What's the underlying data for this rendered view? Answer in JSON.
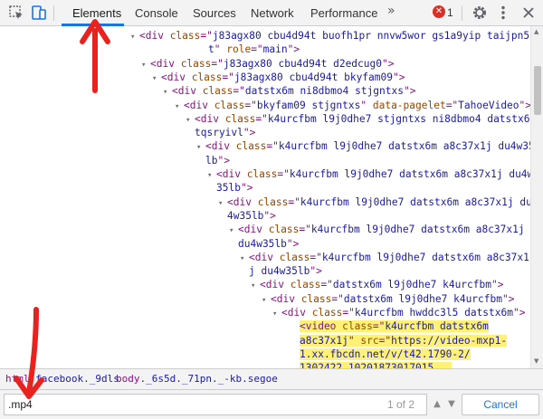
{
  "toolbar": {
    "tabs": [
      {
        "label": "Elements",
        "active": true
      },
      {
        "label": "Console",
        "active": false
      },
      {
        "label": "Sources",
        "active": false
      },
      {
        "label": "Network",
        "active": false
      },
      {
        "label": "Performance",
        "active": false
      }
    ],
    "more_tabs": "»",
    "error_count": "1",
    "icons": [
      "inspect-element-icon",
      "device-toggle-icon",
      "error-icon",
      "settings-gear-icon",
      "more-options-icon"
    ]
  },
  "tree": {
    "lines": [
      {
        "triangle": "▾",
        "parts": [
          [
            "t",
            "<div "
          ],
          [
            "a",
            "class"
          ],
          [
            "t",
            "=\""
          ],
          [
            "v",
            "j83agx80 cbu4d94t buofh1pr nnvw5wor gs1a9yip taijpn5"
          ]
        ]
      },
      {
        "triangle": "",
        "parts": [
          [
            "v",
            "t"
          ],
          [
            "t",
            "\" "
          ],
          [
            "a",
            "role"
          ],
          [
            "t",
            "=\""
          ],
          [
            "v",
            "main"
          ],
          [
            "t",
            "\">"
          ]
        ]
      },
      {
        "triangle": "▾",
        "parts": [
          [
            "t",
            "<div "
          ],
          [
            "a",
            "class"
          ],
          [
            "t",
            "=\""
          ],
          [
            "v",
            "j83agx80 cbu4d94t d2edcug0"
          ],
          [
            "t",
            "\">"
          ]
        ]
      },
      {
        "triangle": "▾",
        "parts": [
          [
            "t",
            "<div "
          ],
          [
            "a",
            "class"
          ],
          [
            "t",
            "=\""
          ],
          [
            "v",
            "j83agx80 cbu4d94t bkyfam09"
          ],
          [
            "t",
            "\">"
          ]
        ]
      },
      {
        "triangle": "▾",
        "parts": [
          [
            "t",
            "<div "
          ],
          [
            "a",
            "class"
          ],
          [
            "t",
            "=\""
          ],
          [
            "v",
            "datstx6m ni8dbmo4 stjgntxs"
          ],
          [
            "t",
            "\">"
          ]
        ]
      },
      {
        "triangle": "▾",
        "parts": [
          [
            "t",
            "<div "
          ],
          [
            "a",
            "class"
          ],
          [
            "t",
            "=\""
          ],
          [
            "v",
            "bkyfam09 stjgntxs"
          ],
          [
            "t",
            "\" "
          ],
          [
            "a",
            "data-pagelet"
          ],
          [
            "t",
            "=\""
          ],
          [
            "v",
            "TahoeVideo"
          ],
          [
            "t",
            "\">"
          ]
        ]
      },
      {
        "triangle": "▾",
        "parts": [
          [
            "t",
            "<div "
          ],
          [
            "a",
            "class"
          ],
          [
            "t",
            "=\""
          ],
          [
            "v",
            "k4urcfbm l9j0dhe7 stjgntxs ni8dbmo4 datstx6m"
          ]
        ]
      },
      {
        "triangle": "",
        "parts": [
          [
            "v",
            "tqsryivl"
          ],
          [
            "t",
            "\">"
          ]
        ]
      },
      {
        "triangle": "▾",
        "parts": [
          [
            "t",
            "<div "
          ],
          [
            "a",
            "class"
          ],
          [
            "t",
            "=\""
          ],
          [
            "v",
            "k4urcfbm l9j0dhe7 datstx6m a8c37x1j du4w35"
          ]
        ]
      },
      {
        "triangle": "",
        "parts": [
          [
            "v",
            "lb"
          ],
          [
            "t",
            "\">"
          ]
        ]
      },
      {
        "triangle": "▾",
        "parts": [
          [
            "t",
            "<div "
          ],
          [
            "a",
            "class"
          ],
          [
            "t",
            "=\""
          ],
          [
            "v",
            "k4urcfbm l9j0dhe7 datstx6m a8c37x1j du4w"
          ]
        ]
      },
      {
        "triangle": "",
        "parts": [
          [
            "v",
            "35lb"
          ],
          [
            "t",
            "\">"
          ]
        ]
      },
      {
        "triangle": "▾",
        "parts": [
          [
            "t",
            "<div "
          ],
          [
            "a",
            "class"
          ],
          [
            "t",
            "=\""
          ],
          [
            "v",
            "k4urcfbm l9j0dhe7 datstx6m a8c37x1j du"
          ]
        ]
      },
      {
        "triangle": "",
        "parts": [
          [
            "v",
            "4w35lb"
          ],
          [
            "t",
            "\">"
          ]
        ]
      },
      {
        "triangle": "▾",
        "parts": [
          [
            "t",
            "<div "
          ],
          [
            "a",
            "class"
          ],
          [
            "t",
            "=\""
          ],
          [
            "v",
            "k4urcfbm l9j0dhe7 datstx6m a8c37x1j"
          ]
        ]
      },
      {
        "triangle": "",
        "parts": [
          [
            "v",
            "du4w35lb"
          ],
          [
            "t",
            "\">"
          ]
        ]
      },
      {
        "triangle": "▾",
        "parts": [
          [
            "t",
            "<div "
          ],
          [
            "a",
            "class"
          ],
          [
            "t",
            "=\""
          ],
          [
            "v",
            "k4urcfbm l9j0dhe7 datstx6m a8c37x1"
          ]
        ]
      },
      {
        "triangle": "",
        "parts": [
          [
            "v",
            "j du4w35lb"
          ],
          [
            "t",
            "\">"
          ]
        ]
      },
      {
        "triangle": "▾",
        "parts": [
          [
            "t",
            "<div "
          ],
          [
            "a",
            "class"
          ],
          [
            "t",
            "=\""
          ],
          [
            "v",
            "datstx6m l9j0dhe7 k4urcfbm"
          ],
          [
            "t",
            "\">"
          ]
        ]
      },
      {
        "triangle": "▾",
        "parts": [
          [
            "t",
            "<div "
          ],
          [
            "a",
            "class"
          ],
          [
            "t",
            "=\""
          ],
          [
            "v",
            "datstx6m l9j0dhe7 k4urcfbm"
          ],
          [
            "t",
            "\">"
          ]
        ]
      },
      {
        "triangle": "▾",
        "parts": [
          [
            "t",
            "<div "
          ],
          [
            "a",
            "class"
          ],
          [
            "t",
            "=\""
          ],
          [
            "v",
            "k4urcfbm hwddc3l5 datstx6m"
          ],
          [
            "t",
            "\">"
          ]
        ]
      },
      {
        "triangle": "",
        "highlight": true,
        "parts": [
          [
            "t",
            "<video "
          ],
          [
            "a",
            "class"
          ],
          [
            "t",
            "=\""
          ],
          [
            "v",
            "k4urcfbm datstx6m"
          ]
        ]
      },
      {
        "triangle": "",
        "highlight": true,
        "parts": [
          [
            "v",
            "a8c37x1j"
          ],
          [
            "t",
            "\" "
          ],
          [
            "a",
            "src"
          ],
          [
            "t",
            "=\""
          ],
          [
            "v",
            "https://video-mxp1-"
          ]
        ]
      },
      {
        "triangle": "",
        "highlight": true,
        "parts": [
          [
            "v",
            "1.xx.fbcdn.net/v/t42.1790-2/"
          ]
        ]
      },
      {
        "triangle": "",
        "highlight": true,
        "parts": [
          [
            "v",
            "1302422_10201873017015..."
          ]
        ]
      }
    ]
  },
  "breadcrumbs": [
    {
      "tag": "html",
      "cls": ".facebook._9dls"
    },
    {
      "tag": "body",
      "cls": "._6s5d._71pn._-kb.segoe"
    }
  ],
  "search": {
    "value": ".mp4",
    "match_count": "1 of 2",
    "cancel_label": "Cancel"
  }
}
